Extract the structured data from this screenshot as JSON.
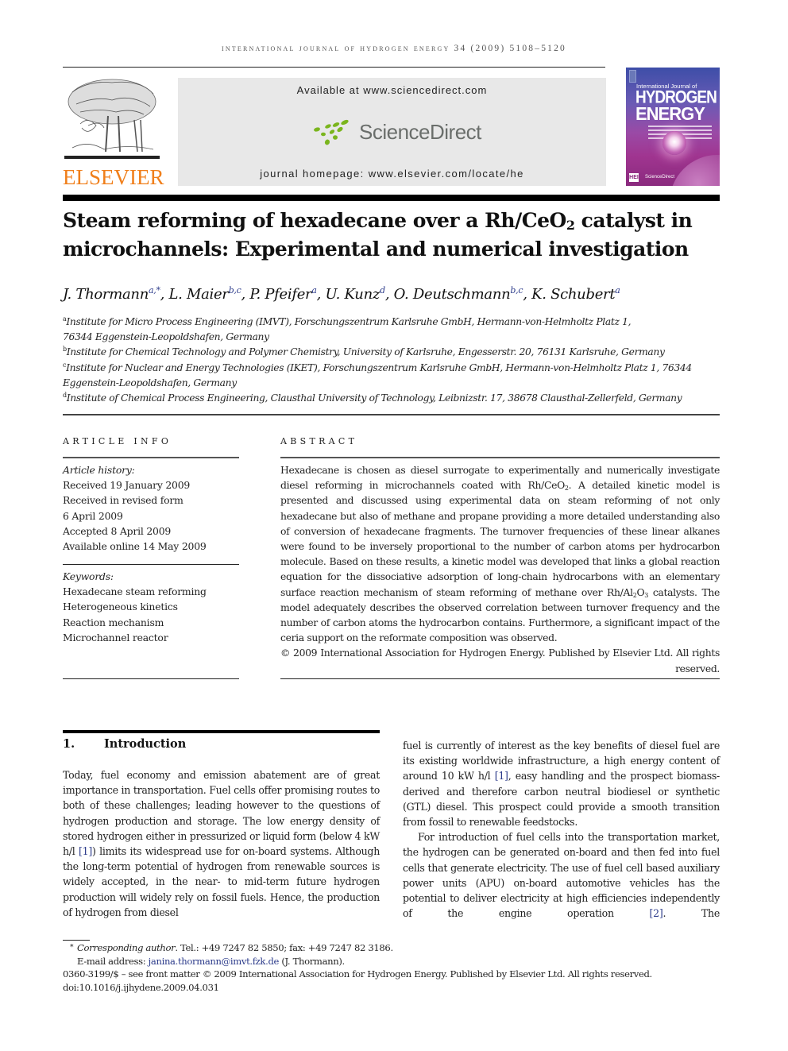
{
  "running_head": "International Journal of Hydrogen Energy 34 (2009) 5108–5120",
  "header": {
    "publisher_logo_text": "ELSEVIER",
    "available_at": "Available at www.sciencedirect.com",
    "sciencedirect_logo_text": "ScienceDirect",
    "journal_homepage": "journal homepage: www.elsevier.com/locate/he",
    "cover": {
      "line1": "International Journal of",
      "line2": "HYDROGEN",
      "line3": "ENERGY",
      "footer_badge": "HEI",
      "footer_text": "ScienceDirect"
    },
    "colors": {
      "elsevier_orange": "#f07f1b",
      "sciencedirect_green": "#7ab51d",
      "sciencedirect_grey": "#6a6e6b",
      "link_blue": "#2b3a8a"
    }
  },
  "article": {
    "title_part1": "Steam reforming of hexadecane over a Rh/CeO",
    "title_sub": "2",
    "title_part2": " catalyst in microchannels: Experimental and numerical investigation",
    "authors": [
      {
        "name": "J. Thormann",
        "sup": "a,*"
      },
      {
        "name": "L. Maier",
        "sup": "b,c"
      },
      {
        "name": "P. Pfeifer",
        "sup": "a"
      },
      {
        "name": "U. Kunz",
        "sup": "d"
      },
      {
        "name": "O. Deutschmann",
        "sup": "b,c"
      },
      {
        "name": "K. Schubert",
        "sup": "a"
      }
    ],
    "affiliations": [
      {
        "label": "a",
        "line1": "Institute for Micro Process Engineering (IMVT), Forschungszentrum Karlsruhe GmbH, Hermann-von-Helmholtz Platz 1,",
        "line2": "76344 Eggenstein-Leopoldshafen, Germany"
      },
      {
        "label": "b",
        "line1": "Institute for Chemical Technology and Polymer Chemistry, University of Karlsruhe, Engesserstr. 20, 76131 Karlsruhe, Germany",
        "line2": ""
      },
      {
        "label": "c",
        "line1": "Institute for Nuclear and Energy Technologies (IKET), Forschungszentrum Karlsruhe GmbH, Hermann-von-Helmholtz Platz 1, 76344",
        "line2": "Eggenstein-Leopoldshafen, Germany"
      },
      {
        "label": "d",
        "line1": "Institute of Chemical Process Engineering, Clausthal University of Technology, Leibnizstr. 17, 38678 Clausthal-Zellerfeld, Germany",
        "line2": ""
      }
    ]
  },
  "article_info": {
    "label": "ARTICLE INFO",
    "history_heading": "Article history:",
    "history": [
      "Received 19 January 2009",
      "Received in revised form",
      "6 April 2009",
      "Accepted 8 April 2009",
      "Available online 14 May 2009"
    ],
    "keywords_heading": "Keywords:",
    "keywords": [
      "Hexadecane steam reforming",
      "Heterogeneous kinetics",
      "Reaction mechanism",
      "Microchannel reactor"
    ]
  },
  "abstract": {
    "label": "ABSTRACT",
    "p1": "Hexadecane is chosen as diesel surrogate to experimentally and numerically investigate diesel reforming in microchannels coated with Rh/CeO",
    "p1_sub": "2",
    "p2": ". A detailed kinetic model is presented and discussed using experimental data on steam reforming of not only hexadecane but also of methane and propane providing a more detailed understanding also of conversion of hexadecane fragments. The turnover frequencies of these linear alkanes were found to be inversely proportional to the number of carbon atoms per hydrocarbon molecule. Based on these results, a kinetic model was developed that links a global reaction equation for the dissociative adsorption of long-chain hydrocarbons with an elementary surface reaction mechanism of steam reforming of methane over Rh/Al",
    "p2_sub1": "2",
    "p3": "O",
    "p3_sub": "3",
    "p4": " catalysts. The model adequately describes the observed correlation between turnover frequency and the number of carbon atoms the hydrocarbon contains. Furthermore, a significant impact of the ceria support on the reformate composition was observed.",
    "copyright": "© 2009 International Association for Hydrogen Energy. Published by Elsevier Ltd. All rights reserved."
  },
  "introduction": {
    "number": "1.",
    "heading": "Introduction",
    "left_p1a": "Today, fuel economy and emission abatement are of great importance in transportation. Fuel cells offer promising routes to both of these challenges; leading however to the questions of hydrogen production and storage. The low energy density of stored hydrogen either in pressurized or liquid form (below 4 kW h/l ",
    "left_cite1": "[1]",
    "left_p1b": ") limits its widespread use for on-board systems. Although the long-term potential of hydrogen from renewable sources is widely accepted, in the near- to mid-term future hydrogen production will widely rely on fossil fuels. Hence, the production of hydrogen from diesel",
    "right_p1a": "fuel is currently of interest as the key benefits of diesel fuel are its existing worldwide infrastructure, a high energy content of around 10 kW h/l ",
    "right_cite1": "[1]",
    "right_p1b": ", easy handling and the prospect biomass-derived and therefore carbon neutral biodiesel or synthetic (GTL) diesel. This prospect could provide a smooth transition from fossil to renewable feedstocks.",
    "right_p2a": "For introduction of fuel cells into the transportation market, the hydrogen can be generated on-board and then fed into fuel cells that generate electricity. The use of fuel cell based auxiliary power units (APU) on-board automotive vehicles has the potential to deliver electricity at high efficiencies independently of the engine operation ",
    "right_cite2": "[2]",
    "right_p2b": ". The"
  },
  "footnotes": {
    "star": "*",
    "corresponding_label": "Corresponding author",
    "corresponding_contact": ". Tel.: +49 7247 82 5850; fax: +49 7247 82 3186.",
    "email_label": "E-mail address: ",
    "email": "janina.thormann@imvt.fzk.de",
    "email_suffix": " (J. Thormann).",
    "front_matter": "0360-3199/$ – see front matter © 2009 International Association for Hydrogen Energy. Published by Elsevier Ltd. All rights reserved.",
    "doi": "doi:10.1016/j.ijhydene.2009.04.031"
  }
}
